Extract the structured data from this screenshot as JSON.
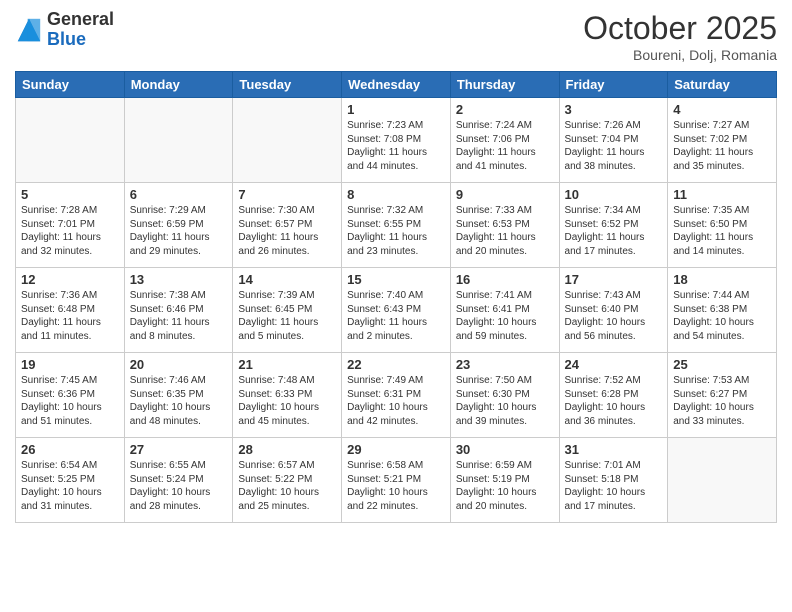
{
  "logo": {
    "general": "General",
    "blue": "Blue"
  },
  "header": {
    "month": "October 2025",
    "location": "Boureni, Dolj, Romania"
  },
  "weekdays": [
    "Sunday",
    "Monday",
    "Tuesday",
    "Wednesday",
    "Thursday",
    "Friday",
    "Saturday"
  ],
  "weeks": [
    [
      {
        "day": "",
        "info": ""
      },
      {
        "day": "",
        "info": ""
      },
      {
        "day": "",
        "info": ""
      },
      {
        "day": "1",
        "info": "Sunrise: 7:23 AM\nSunset: 7:08 PM\nDaylight: 11 hours\nand 44 minutes."
      },
      {
        "day": "2",
        "info": "Sunrise: 7:24 AM\nSunset: 7:06 PM\nDaylight: 11 hours\nand 41 minutes."
      },
      {
        "day": "3",
        "info": "Sunrise: 7:26 AM\nSunset: 7:04 PM\nDaylight: 11 hours\nand 38 minutes."
      },
      {
        "day": "4",
        "info": "Sunrise: 7:27 AM\nSunset: 7:02 PM\nDaylight: 11 hours\nand 35 minutes."
      }
    ],
    [
      {
        "day": "5",
        "info": "Sunrise: 7:28 AM\nSunset: 7:01 PM\nDaylight: 11 hours\nand 32 minutes."
      },
      {
        "day": "6",
        "info": "Sunrise: 7:29 AM\nSunset: 6:59 PM\nDaylight: 11 hours\nand 29 minutes."
      },
      {
        "day": "7",
        "info": "Sunrise: 7:30 AM\nSunset: 6:57 PM\nDaylight: 11 hours\nand 26 minutes."
      },
      {
        "day": "8",
        "info": "Sunrise: 7:32 AM\nSunset: 6:55 PM\nDaylight: 11 hours\nand 23 minutes."
      },
      {
        "day": "9",
        "info": "Sunrise: 7:33 AM\nSunset: 6:53 PM\nDaylight: 11 hours\nand 20 minutes."
      },
      {
        "day": "10",
        "info": "Sunrise: 7:34 AM\nSunset: 6:52 PM\nDaylight: 11 hours\nand 17 minutes."
      },
      {
        "day": "11",
        "info": "Sunrise: 7:35 AM\nSunset: 6:50 PM\nDaylight: 11 hours\nand 14 minutes."
      }
    ],
    [
      {
        "day": "12",
        "info": "Sunrise: 7:36 AM\nSunset: 6:48 PM\nDaylight: 11 hours\nand 11 minutes."
      },
      {
        "day": "13",
        "info": "Sunrise: 7:38 AM\nSunset: 6:46 PM\nDaylight: 11 hours\nand 8 minutes."
      },
      {
        "day": "14",
        "info": "Sunrise: 7:39 AM\nSunset: 6:45 PM\nDaylight: 11 hours\nand 5 minutes."
      },
      {
        "day": "15",
        "info": "Sunrise: 7:40 AM\nSunset: 6:43 PM\nDaylight: 11 hours\nand 2 minutes."
      },
      {
        "day": "16",
        "info": "Sunrise: 7:41 AM\nSunset: 6:41 PM\nDaylight: 10 hours\nand 59 minutes."
      },
      {
        "day": "17",
        "info": "Sunrise: 7:43 AM\nSunset: 6:40 PM\nDaylight: 10 hours\nand 56 minutes."
      },
      {
        "day": "18",
        "info": "Sunrise: 7:44 AM\nSunset: 6:38 PM\nDaylight: 10 hours\nand 54 minutes."
      }
    ],
    [
      {
        "day": "19",
        "info": "Sunrise: 7:45 AM\nSunset: 6:36 PM\nDaylight: 10 hours\nand 51 minutes."
      },
      {
        "day": "20",
        "info": "Sunrise: 7:46 AM\nSunset: 6:35 PM\nDaylight: 10 hours\nand 48 minutes."
      },
      {
        "day": "21",
        "info": "Sunrise: 7:48 AM\nSunset: 6:33 PM\nDaylight: 10 hours\nand 45 minutes."
      },
      {
        "day": "22",
        "info": "Sunrise: 7:49 AM\nSunset: 6:31 PM\nDaylight: 10 hours\nand 42 minutes."
      },
      {
        "day": "23",
        "info": "Sunrise: 7:50 AM\nSunset: 6:30 PM\nDaylight: 10 hours\nand 39 minutes."
      },
      {
        "day": "24",
        "info": "Sunrise: 7:52 AM\nSunset: 6:28 PM\nDaylight: 10 hours\nand 36 minutes."
      },
      {
        "day": "25",
        "info": "Sunrise: 7:53 AM\nSunset: 6:27 PM\nDaylight: 10 hours\nand 33 minutes."
      }
    ],
    [
      {
        "day": "26",
        "info": "Sunrise: 6:54 AM\nSunset: 5:25 PM\nDaylight: 10 hours\nand 31 minutes."
      },
      {
        "day": "27",
        "info": "Sunrise: 6:55 AM\nSunset: 5:24 PM\nDaylight: 10 hours\nand 28 minutes."
      },
      {
        "day": "28",
        "info": "Sunrise: 6:57 AM\nSunset: 5:22 PM\nDaylight: 10 hours\nand 25 minutes."
      },
      {
        "day": "29",
        "info": "Sunrise: 6:58 AM\nSunset: 5:21 PM\nDaylight: 10 hours\nand 22 minutes."
      },
      {
        "day": "30",
        "info": "Sunrise: 6:59 AM\nSunset: 5:19 PM\nDaylight: 10 hours\nand 20 minutes."
      },
      {
        "day": "31",
        "info": "Sunrise: 7:01 AM\nSunset: 5:18 PM\nDaylight: 10 hours\nand 17 minutes."
      },
      {
        "day": "",
        "info": ""
      }
    ]
  ]
}
